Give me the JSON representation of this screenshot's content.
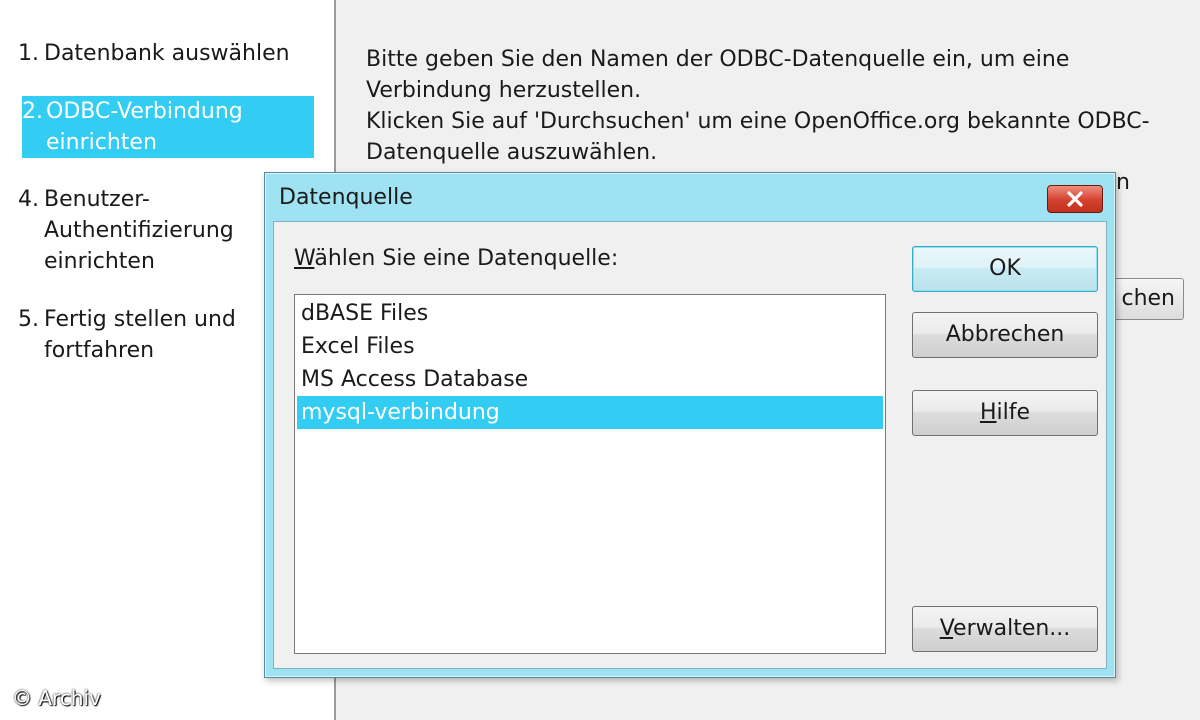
{
  "steps": [
    {
      "num": "1.",
      "label": "Datenbank auswählen"
    },
    {
      "num": "2.",
      "label": "ODBC-Verbindung\neinrichten",
      "active": true
    },
    {
      "num": "4.",
      "label": "Benutzer-\nAuthentifizierung\neinrichten"
    },
    {
      "num": "5.",
      "label": "Fertig stellen und\nfortfahren"
    }
  ],
  "main": {
    "instructions": "Bitte geben Sie den Namen der ODBC-Datenquelle ein, um eine\nVerbindung herzustellen.\nKlicken Sie auf 'Durchsuchen' um eine OpenOffice.org bekannte ODBC-\nDatenquelle auszuwählen.",
    "partial_text": "n",
    "browse_button_partial": "chen"
  },
  "dialog": {
    "title": "Datenquelle",
    "list_label_mnemonic": "W",
    "list_label_rest": "ählen Sie eine Datenquelle:",
    "items": [
      {
        "label": "dBASE Files"
      },
      {
        "label": "Excel Files"
      },
      {
        "label": "MS Access Database"
      },
      {
        "label": "mysql-verbindung",
        "selected": true
      }
    ],
    "buttons": {
      "ok": "OK",
      "cancel": "Abbrechen",
      "help_mnemonic": "H",
      "help_rest": "ilfe",
      "manage_mnemonic": "V",
      "manage_rest": "erwalten..."
    }
  },
  "watermark": "© Archiv",
  "colors": {
    "selection": "#33ccf2",
    "dialog_frame": "#9fe3f2",
    "close_button": "#d4412f"
  }
}
